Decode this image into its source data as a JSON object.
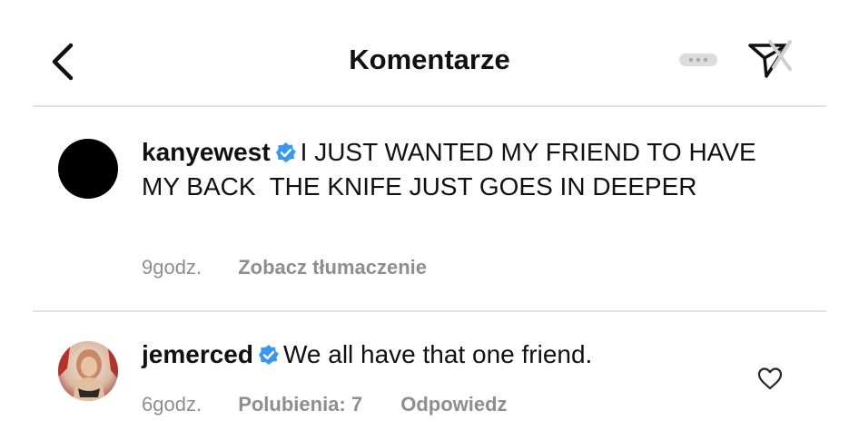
{
  "header": {
    "title": "Komentarze"
  },
  "comments": [
    {
      "username": "kanyewest",
      "verified": true,
      "text": "I JUST WANTED MY FRIEND TO HAVE MY BACK  THE KNIFE JUST GOES IN DEEPER",
      "time": "9godz.",
      "translate_label": "Zobacz tłumaczenie"
    },
    {
      "username": "jemerced",
      "verified": true,
      "text": "We all have that one friend.",
      "time": "6godz.",
      "likes_label": "Polubienia: 7",
      "reply_label": "Odpowiedz"
    }
  ],
  "colors": {
    "verified_badge": "#3897f0",
    "meta_text": "#8e8e8e",
    "divider": "#e2e2e2"
  },
  "icons": [
    "back-arrow-icon",
    "more-dots-icon",
    "send-icon",
    "verified-badge-icon",
    "heart-icon"
  ]
}
